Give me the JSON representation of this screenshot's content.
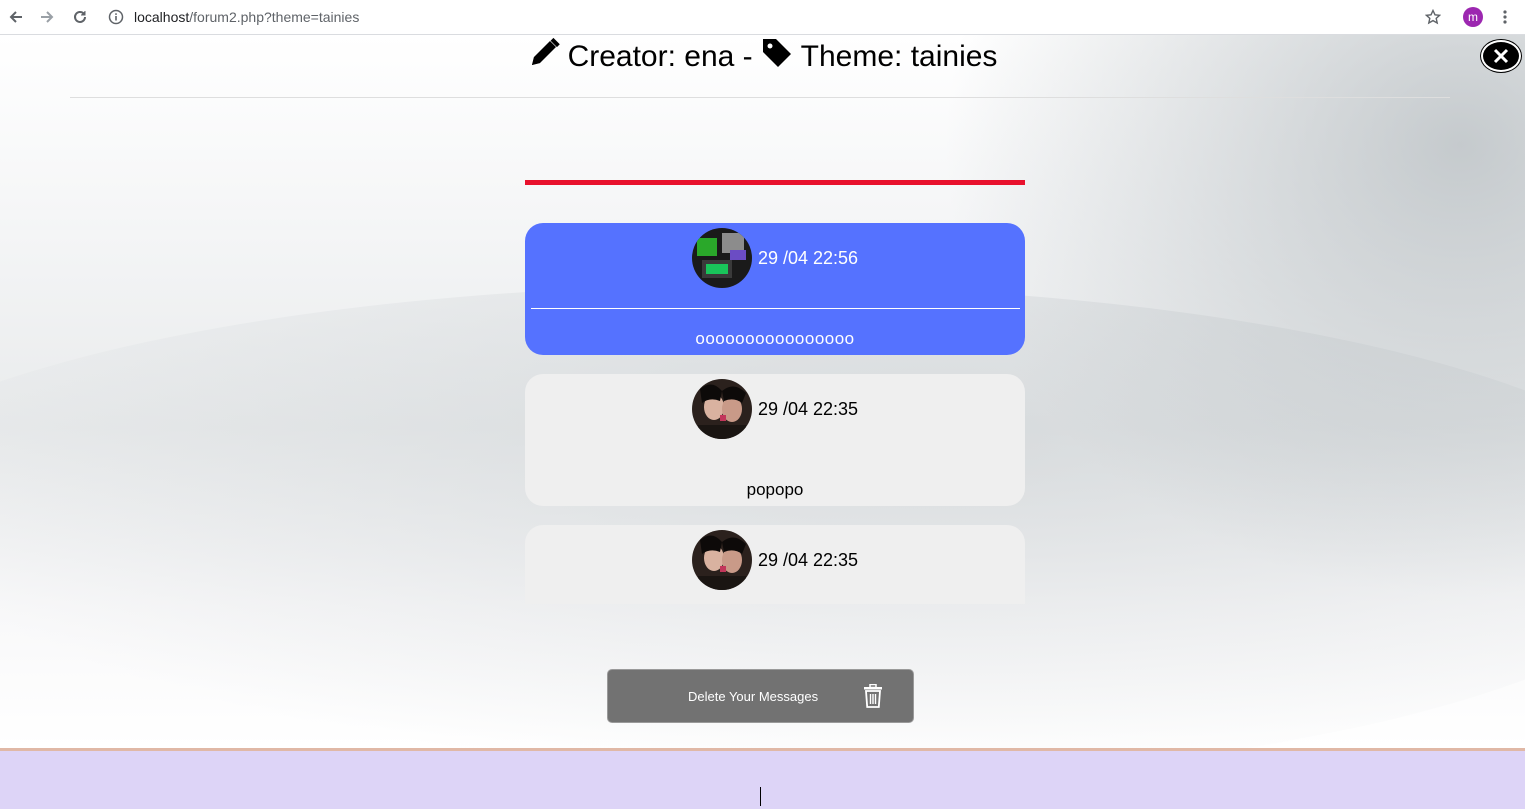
{
  "browser": {
    "url_host": "localhost",
    "url_path": "/forum2.php?theme=tainies",
    "profile_initial": "m"
  },
  "header": {
    "creator_text": "Creator: ena -",
    "theme_text": "Theme: tainies"
  },
  "messages": [
    {
      "timestamp": "29 /04 22:56",
      "text": "oooooooooooooooo",
      "own": true
    },
    {
      "timestamp": "29 /04 22:35",
      "text": "popopo",
      "own": false
    },
    {
      "timestamp": "29 /04 22:35",
      "text": "",
      "own": false
    }
  ],
  "actions": {
    "delete_label": "Delete Your Messages"
  },
  "colors": {
    "own_message_bg": "#5572ff",
    "other_message_bg": "#efefef",
    "divider_red": "#e8112d",
    "delete_button_bg": "#727272",
    "footer_bg": "#ddd4f7"
  }
}
